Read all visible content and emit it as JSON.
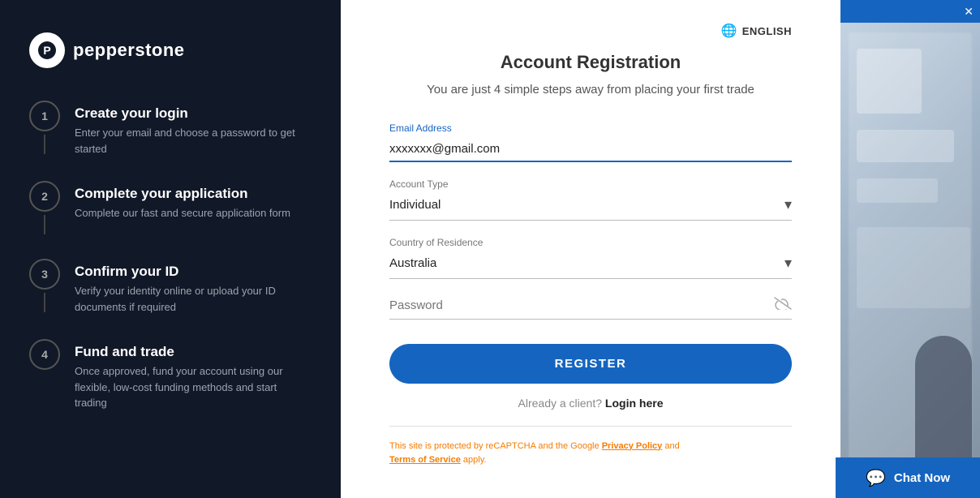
{
  "left": {
    "logo_text": "pepperstone",
    "steps": [
      {
        "number": "1",
        "title": "Create your login",
        "desc": "Enter your email and choose a password to get started"
      },
      {
        "number": "2",
        "title": "Complete your application",
        "desc": "Complete our fast and secure application form"
      },
      {
        "number": "3",
        "title": "Confirm your ID",
        "desc": "Verify your identity online or upload your ID documents if required"
      },
      {
        "number": "4",
        "title": "Fund and trade",
        "desc": "Once approved, fund your account using our flexible, low-cost funding methods and start trading"
      }
    ]
  },
  "form": {
    "lang_label": "ENGLISH",
    "title": "Account Registration",
    "subtitle": "You are just 4 simple steps away from placing your first trade",
    "email_label": "Email Address",
    "email_value": "xxxxxxx@gmail.com",
    "account_type_label": "Account Type",
    "account_type_value": "Individual",
    "country_label": "Country of Residence",
    "country_value": "Australia",
    "password_label": "Password",
    "password_placeholder": "Password",
    "register_btn": "REGISTER",
    "already_client": "Already a client?",
    "login_link": "Login here",
    "recaptcha_line1": "This site is protected by reCAPTCHA and the Google",
    "privacy_policy": "Privacy Policy",
    "recaptcha_line2": "and",
    "tos": "Terms of Service",
    "recaptcha_line3": "apply."
  },
  "chat": {
    "label": "Chat Now"
  }
}
